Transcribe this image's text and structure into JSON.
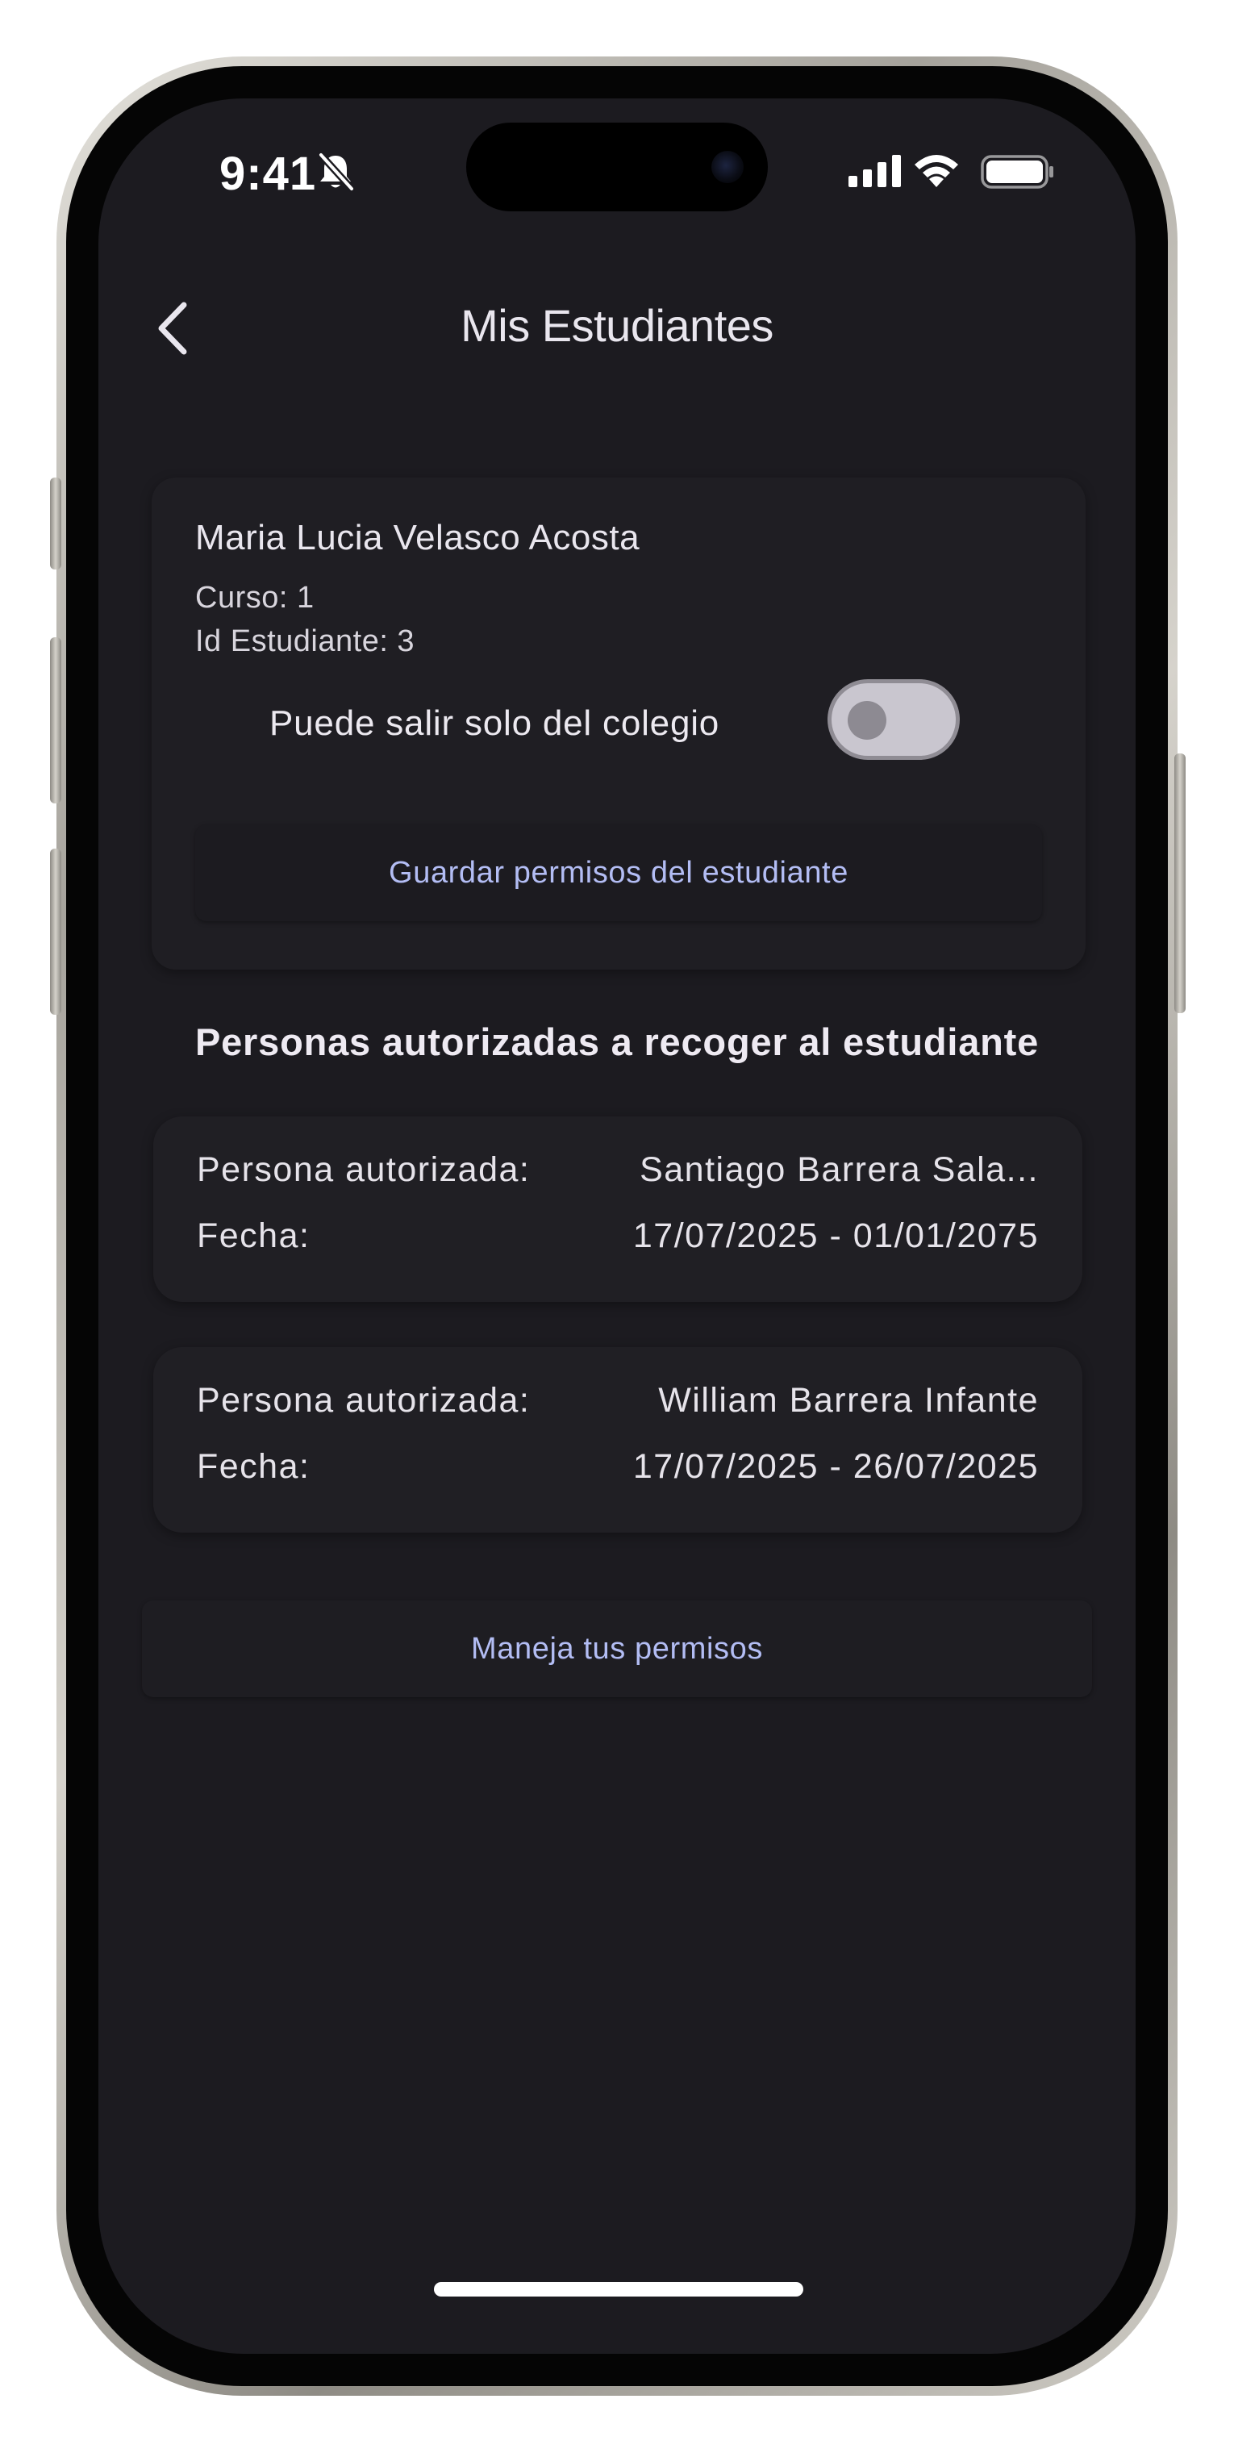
{
  "status_bar": {
    "time": "9:41",
    "icons": [
      "bell-slash-icon",
      "cellular-signal-icon",
      "wifi-icon",
      "battery-icon"
    ]
  },
  "header": {
    "title": "Mis Estudiantes",
    "back_icon": "chevron-left-icon"
  },
  "student": {
    "name": "Maria Lucia Velasco Acosta",
    "curso": "Curso: 1",
    "id": "Id Estudiante: 3",
    "toggle_label": "Puede salir solo del colegio",
    "toggle_on": false,
    "save_button": "Guardar permisos del estudiante"
  },
  "authorized": {
    "section_title": "Personas autorizadas a recoger al estudiante",
    "items": [
      {
        "person_label": "Persona autorizada:",
        "person_value": "Santiago Barrera Sala...",
        "date_label": "Fecha:",
        "date_value": "17/07/2025 - 01/01/2075"
      },
      {
        "person_label": "Persona autorizada:",
        "person_value": "William Barrera Infante",
        "date_label": "Fecha:",
        "date_value": "17/07/2025 - 26/07/2025"
      }
    ]
  },
  "manage_button": "Maneja tus permisos",
  "colors": {
    "background": "#1c1b20",
    "card": "#201f24",
    "accent_text": "#b3bdf4",
    "primary_text": "#e9e6ee"
  }
}
